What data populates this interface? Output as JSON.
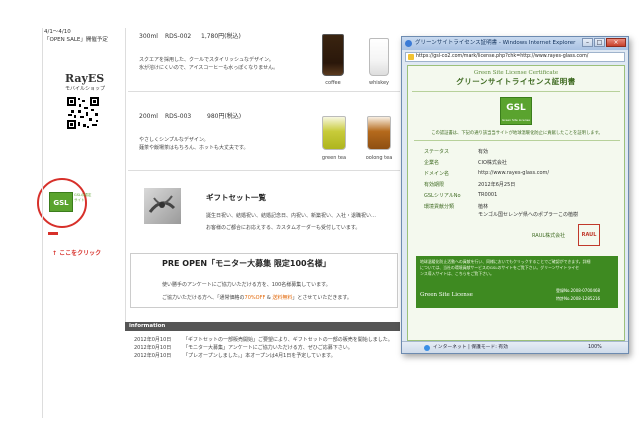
{
  "left_column": {
    "period": "4/1〜4/10",
    "notice": "「OPEN SALE」開催予定",
    "shop_name": "RayES",
    "shop_sub": "モバイルショップ",
    "click_here": "↑ ここをクリック"
  },
  "products": [
    {
      "size": "300ml",
      "code": "RDS-002",
      "price": "1,780円(税込)",
      "desc1": "スクエアを採用した、クールでスタイリッシュなデザイン。",
      "desc2": "氷が溶けにくいので、アイスコーヒーも水っぽくなりません。",
      "img1_caption": "coffee",
      "img2_caption": "whiskey"
    },
    {
      "size": "200ml",
      "code": "RDS-003",
      "price": "980円(税込)",
      "desc1": "やさしくシンプルなデザイン。",
      "desc2": "麺茶や飯場茶はもちろん、ホットも大丈夫です。",
      "img1_caption": "green tea",
      "img2_caption": "oolong tea"
    }
  ],
  "gift": {
    "title": "ギフトセット一覧",
    "desc1": "誕生日祝い、結婚祝い、結婚記念日、内祝い、新築祝い、入社・退職祝い…",
    "desc2": "お客様のご都合にお応えする、カスタムオーダーも受付しています。"
  },
  "preopen": {
    "title": "PRE OPEN「モニター大募集 限定100名様」",
    "line1": "使い勝手のアンケートにご協力いただける方を、100名様募集しています。",
    "line2a": "ご協力いただける方へ、「通常価格の",
    "line2b": "70%OFF",
    "line2c": " & ",
    "line2d": "送料無料",
    "line2e": "」とさせていただきます。"
  },
  "information": {
    "header": "information",
    "items": [
      {
        "date": "2012年0月10日",
        "text": "「ギフトセットの一部販売開始」ご要望により、ギフトセットの一部の販売を開始しました。"
      },
      {
        "date": "2012年0月10日",
        "text": "「モニター大募集」アンケートにご協力いただける方、ぜひご応募下さい。"
      },
      {
        "date": "2012年0月10日",
        "text": "「プレオープンしました。」本オープンは4月1日を予定しています。"
      }
    ]
  },
  "ie_window": {
    "title": "グリーンサイトライセンス証明書 - Windows Internet Explorer",
    "min": "–",
    "max": "□",
    "close": "×",
    "address": "https://gsl-co2.com/mark/license.php?chk=http://www.rayes-glass.com/",
    "cert_title_en": "Green Site License Certificate",
    "cert_title_jp": "グリーンサイトライセンス証明書",
    "logo_text": "GSL",
    "logo_sub": "Green Site License",
    "cert_intro": "この認証書は、下記の通り該当当サイトが地球温暖化防止に貢献したことを証明します。",
    "rows": [
      {
        "label": "ステータス",
        "value": "有効"
      },
      {
        "label": "企業名",
        "value": "CIO株式会社"
      },
      {
        "label": "ドメイン名",
        "value": "http://www.rayes-glass.com/"
      },
      {
        "label": "有効期限",
        "value": "2012年6月25日"
      },
      {
        "label": "GSLシリアルNo",
        "value": "TR0001"
      },
      {
        "label": "環境貢献分類",
        "value": "植林"
      },
      {
        "label": "",
        "value": "モンゴル国セレンゲ県へのポプラーこの植樹"
      }
    ],
    "issuer": "RAUL株式会社",
    "seal": "RAUL",
    "green_text1": "地球温暖化防止活動への貢献を行い、同様においてもクリックすることでご確認ができます。詳細",
    "green_text2": "については、当社の環境貢献サービスのGSLのサイトをご覧下さい。グリーンサイトライセ",
    "green_text3": "ンス導入サイトは、こちらをご覧下さい。",
    "green_footer": "Green Site License",
    "green_no1": "登録No.2008-0700468",
    "green_no2": "特許No.2008-1285216",
    "status_zone": "インターネット | 保護モード: 有効",
    "status_zoom": "100%"
  },
  "page_gsl_badge": {
    "logo_text": "GSL",
    "side_text": "GSLの認定サイト"
  }
}
